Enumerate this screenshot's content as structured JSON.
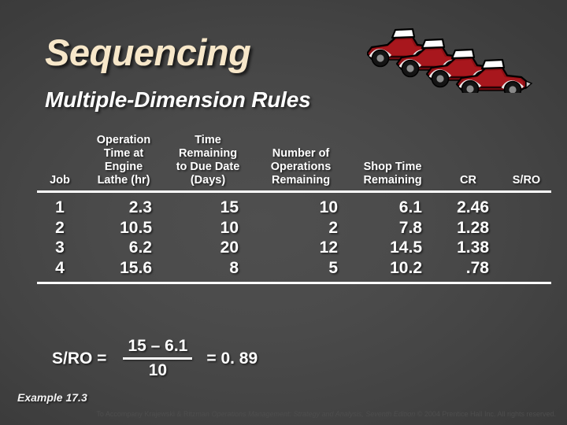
{
  "slide": {
    "title": "Sequencing",
    "subtitle": "Multiple-Dimension Rules",
    "title_color": "#F7E7C9",
    "subtitle_color": "#FFFFFF",
    "background_color": "#444444",
    "artwork": "four-red-vintage-cars"
  },
  "table": {
    "headers": [
      {
        "key": "job",
        "lines": [
          "Job"
        ]
      },
      {
        "key": "operation_time",
        "lines": [
          "Operation",
          "Time at",
          "Engine",
          "Lathe (hr)"
        ]
      },
      {
        "key": "time_remaining",
        "lines": [
          "Time",
          "Remaining",
          "to Due Date",
          "(Days)"
        ]
      },
      {
        "key": "operations_remaining",
        "lines": [
          "Number of",
          "Operations",
          "Remaining"
        ]
      },
      {
        "key": "shop_time_remaining",
        "lines": [
          "Shop Time",
          "Remaining"
        ]
      },
      {
        "key": "cr",
        "lines": [
          "CR"
        ]
      },
      {
        "key": "sro",
        "lines": [
          "S/RO"
        ]
      }
    ],
    "rows": [
      {
        "job": "1",
        "operation_time": "2.3",
        "time_remaining": "15",
        "operations_remaining": "10",
        "shop_time_remaining": "6.1",
        "cr": "2.46",
        "sro": ""
      },
      {
        "job": "2",
        "operation_time": "10.5",
        "time_remaining": "10",
        "operations_remaining": "2",
        "shop_time_remaining": "7.8",
        "cr": "1.28",
        "sro": ""
      },
      {
        "job": "3",
        "operation_time": "6.2",
        "time_remaining": "20",
        "operations_remaining": "12",
        "shop_time_remaining": "14.5",
        "cr": "1.38",
        "sro": ""
      },
      {
        "job": "4",
        "operation_time": "15.6",
        "time_remaining": "8",
        "operations_remaining": "5",
        "shop_time_remaining": "10.2",
        "cr": ".78",
        "sro": ""
      }
    ]
  },
  "formula": {
    "label": "S/RO =",
    "numerator": "15 – 6.1",
    "denominator": "10",
    "equals": "= 0. 89"
  },
  "footer": {
    "example": "Example 17.3",
    "copyright_prefix": "To Accompany Krajewski & Ritzman ",
    "copyright_italic": "Operations Management: Strategy and Analysis, Seventh Edition",
    "copyright_suffix": " © 2004 Prentice Hall Inc. All rights reserved."
  }
}
